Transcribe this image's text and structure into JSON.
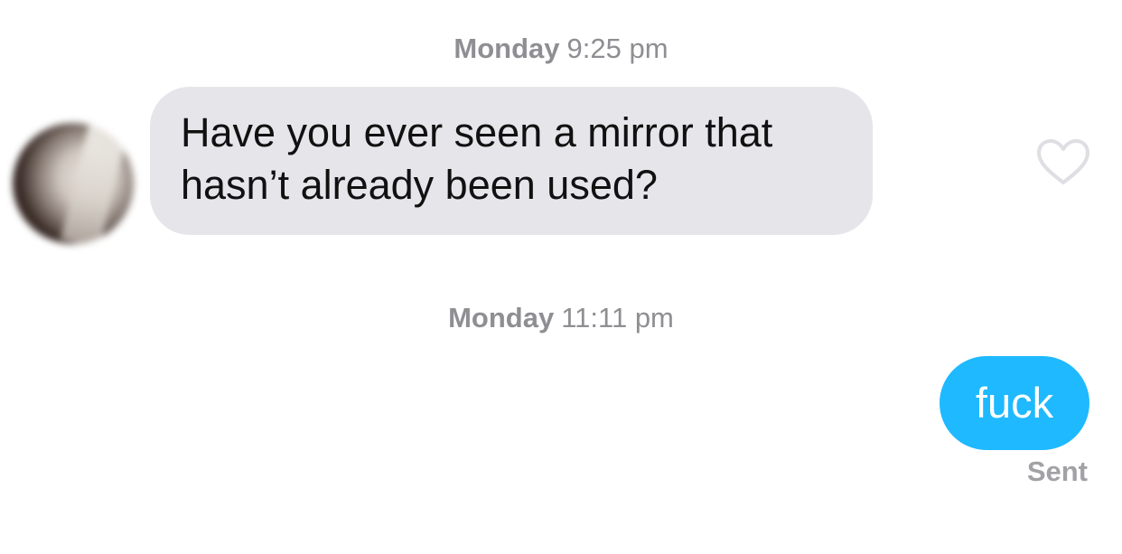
{
  "messages": [
    {
      "timestamp_day": "Monday",
      "timestamp_time": "9:25 pm",
      "direction": "incoming",
      "line1": "Have you ever seen a mirror that",
      "line2": "hasn’t already been used?",
      "liked_icon": "heart-outline-icon"
    },
    {
      "timestamp_day": "Monday",
      "timestamp_time": "11:11 pm",
      "direction": "outgoing",
      "text": "fuck",
      "status": "Sent"
    }
  ],
  "colors": {
    "incoming_bubble": "#e5e5ea",
    "outgoing_bubble": "#1fb9ff",
    "timestamp_text": "#8e8e93",
    "status_text": "#a1a1a6"
  }
}
